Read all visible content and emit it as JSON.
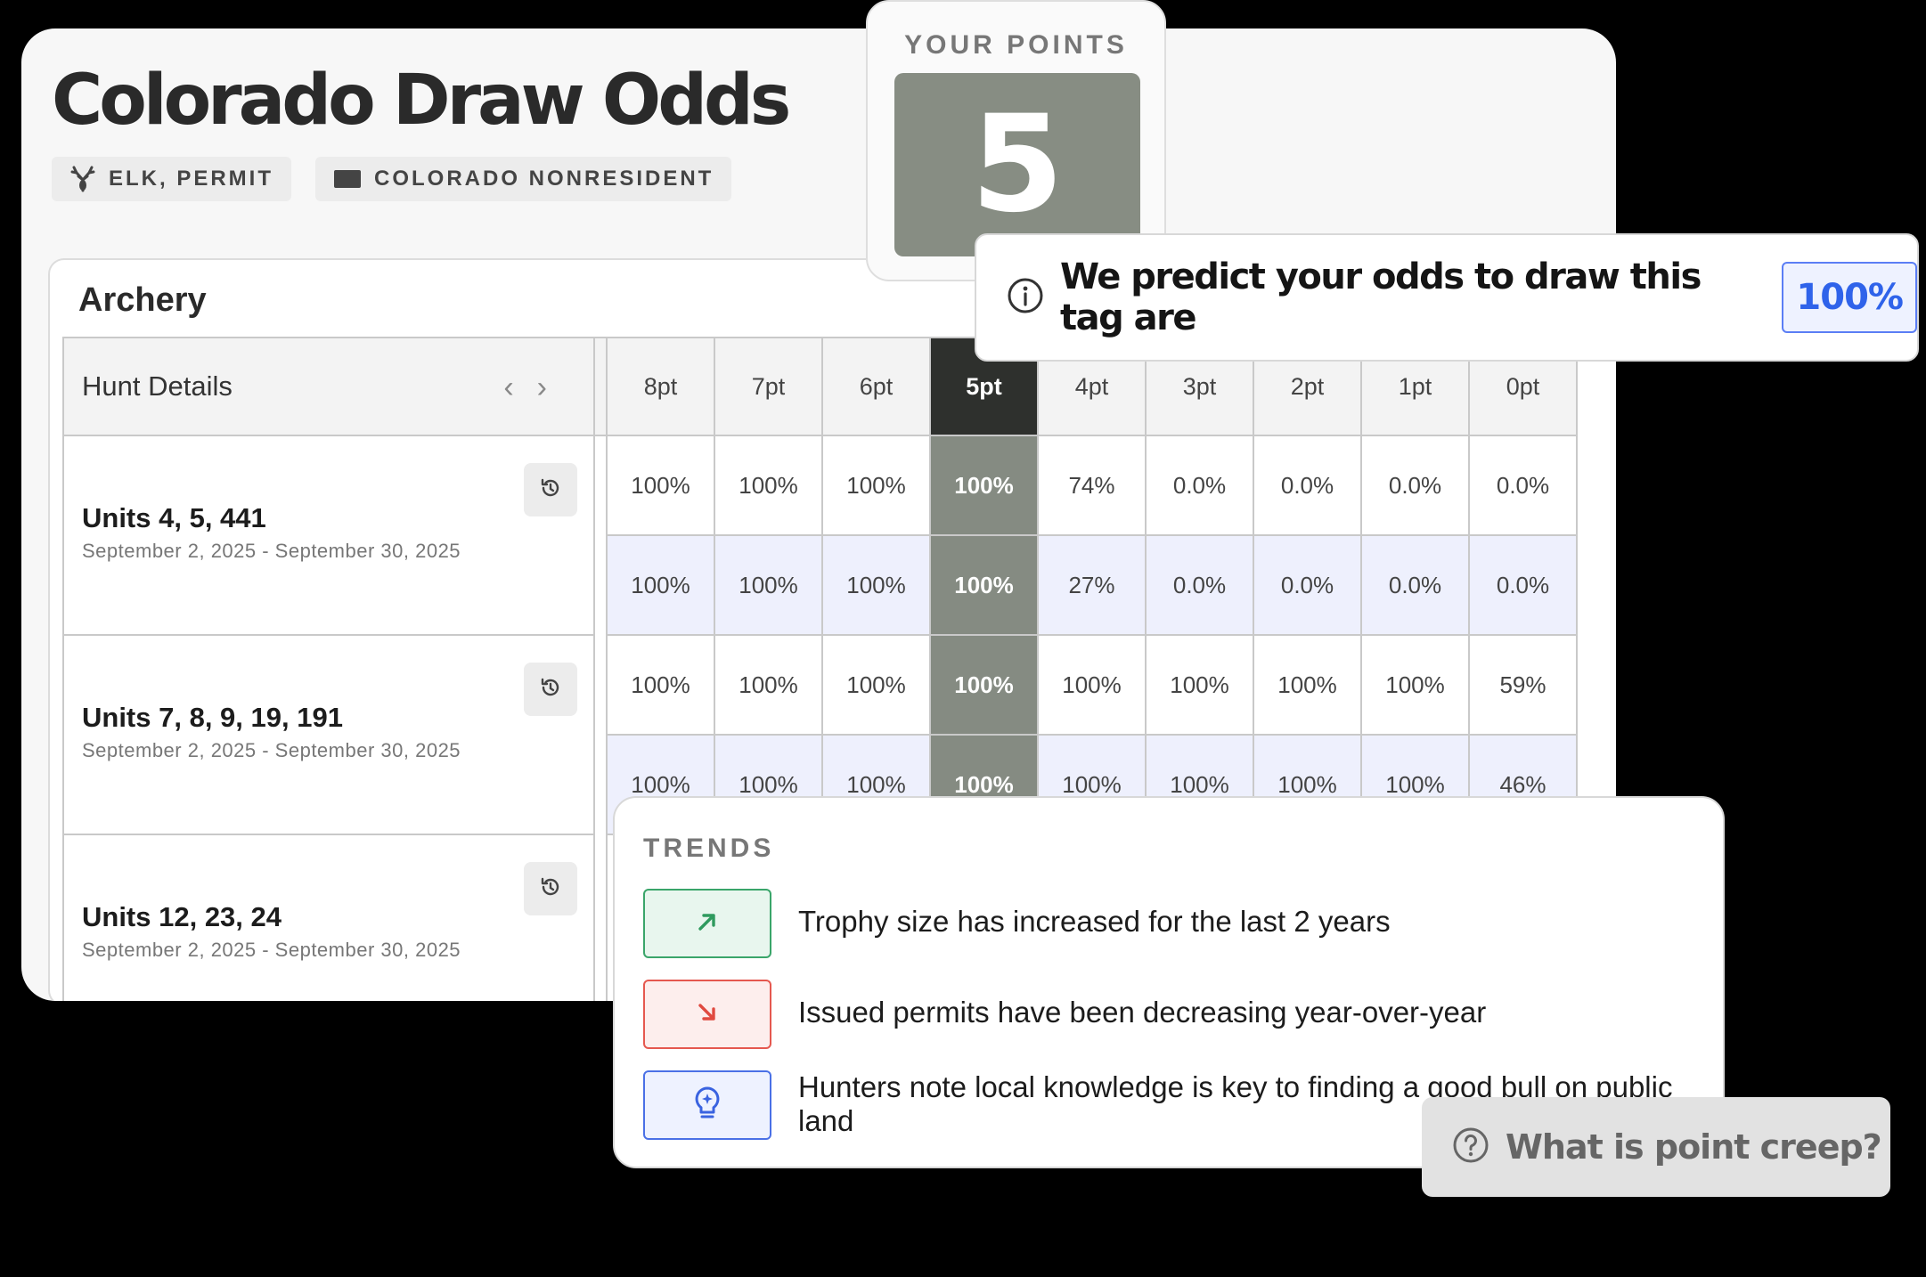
{
  "header": {
    "title": "Colorado Draw Odds",
    "species_chip": "ELK, PERMIT",
    "residency_chip": "COLORADO NONRESIDENT",
    "species_icon": "deer-antler-icon",
    "residency_icon": "colorado-flag-icon"
  },
  "points": {
    "label": "YOUR POINTS",
    "value": "5"
  },
  "prediction": {
    "text": "We predict your odds to draw this tag are",
    "value": "100%",
    "icon": "info-icon"
  },
  "table": {
    "section_label": "Archery",
    "details_header": "Hunt Details",
    "columns": [
      "8pt",
      "7pt",
      "6pt",
      "5pt",
      "4pt",
      "3pt",
      "2pt",
      "1pt",
      "0pt"
    ],
    "selected_column": "5pt",
    "units": [
      {
        "name": "Units 4, 5, 441",
        "dates": "September 2, 2025 - September 30, 2025",
        "rows": [
          [
            "100%",
            "100%",
            "100%",
            "100%",
            "74%",
            "0.0%",
            "0.0%",
            "0.0%",
            "0.0%"
          ],
          [
            "100%",
            "100%",
            "100%",
            "100%",
            "27%",
            "0.0%",
            "0.0%",
            "0.0%",
            "0.0%"
          ]
        ]
      },
      {
        "name": "Units 7, 8, 9, 19, 191",
        "dates": "September 2, 2025 - September 30, 2025",
        "rows": [
          [
            "100%",
            "100%",
            "100%",
            "100%",
            "100%",
            "100%",
            "100%",
            "100%",
            "59%"
          ],
          [
            "100%",
            "100%",
            "100%",
            "100%",
            "100%",
            "100%",
            "100%",
            "100%",
            "46%"
          ]
        ]
      },
      {
        "name": "Units 12, 23, 24",
        "dates": "September 2, 2025 - September 30, 2025",
        "rows": []
      }
    ]
  },
  "trends": {
    "title": "TRENDS",
    "items": [
      {
        "text": "Trophy size has increased for the last 2 years",
        "icon": "trend-up-icon",
        "color": "#3aa56a"
      },
      {
        "text": "Issued permits have been decreasing year-over-year",
        "icon": "trend-down-icon",
        "color": "#e5584f"
      },
      {
        "text": "Hunters note local knowledge is key to finding a good bull on public land",
        "icon": "lightbulb-icon",
        "color": "#4a70e6"
      }
    ]
  },
  "help": {
    "label": "What is point creep?",
    "icon": "question-circle-icon"
  },
  "colors": {
    "selected_header": "#2e302d",
    "selected_cell": "#858b82",
    "alt_row": "#eef0fd",
    "accent_blue": "#2f63ea"
  }
}
